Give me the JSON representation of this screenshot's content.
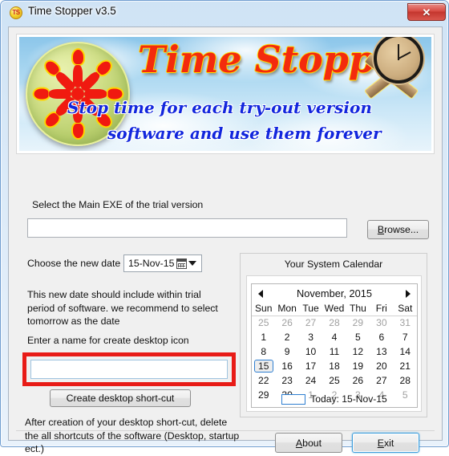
{
  "window": {
    "title": "Time Stopper v3.5",
    "icon_label": "TS",
    "close_label": "✕"
  },
  "banner": {
    "title": "Time Stopper",
    "subtitle_line1": "Stop time for each try-out version",
    "subtitle_line2": "software and use them forever"
  },
  "form": {
    "exe_label": "Select the Main EXE of the trial version",
    "exe_value": "",
    "exe_placeholder": "",
    "browse_label": "Browse...",
    "browse_accesskey": "B",
    "date_label": "Choose the new date",
    "date_value": "15-Nov-15",
    "hint_paragraph": "This new date should include within trial period of software. we recommend to select tomorrow as the date",
    "name_label": "Enter a name for create desktop icon",
    "name_value": "",
    "name_placeholder": "",
    "create_shortcut_label": "Create desktop short-cut",
    "footer_note": "After creation of your desktop short-cut, delete the all shortcuts of the software (Desktop, startup ect.)"
  },
  "calendar": {
    "group_title": "Your System Calendar",
    "month_label": "November, 2015",
    "prev_label": "◄",
    "next_label": "►",
    "weekdays": [
      "Sun",
      "Mon",
      "Tue",
      "Wed",
      "Thu",
      "Fri",
      "Sat"
    ],
    "weeks": [
      [
        {
          "d": "25",
          "dim": true
        },
        {
          "d": "26",
          "dim": true
        },
        {
          "d": "27",
          "dim": true
        },
        {
          "d": "28",
          "dim": true
        },
        {
          "d": "29",
          "dim": true
        },
        {
          "d": "30",
          "dim": true
        },
        {
          "d": "31",
          "dim": true
        }
      ],
      [
        {
          "d": "1"
        },
        {
          "d": "2"
        },
        {
          "d": "3"
        },
        {
          "d": "4"
        },
        {
          "d": "5"
        },
        {
          "d": "6"
        },
        {
          "d": "7"
        }
      ],
      [
        {
          "d": "8"
        },
        {
          "d": "9"
        },
        {
          "d": "10"
        },
        {
          "d": "11"
        },
        {
          "d": "12"
        },
        {
          "d": "13"
        },
        {
          "d": "14"
        }
      ],
      [
        {
          "d": "15",
          "selected": true
        },
        {
          "d": "16"
        },
        {
          "d": "17"
        },
        {
          "d": "18"
        },
        {
          "d": "19"
        },
        {
          "d": "20"
        },
        {
          "d": "21"
        }
      ],
      [
        {
          "d": "22"
        },
        {
          "d": "23"
        },
        {
          "d": "24"
        },
        {
          "d": "25"
        },
        {
          "d": "26"
        },
        {
          "d": "27"
        },
        {
          "d": "28"
        }
      ],
      [
        {
          "d": "29"
        },
        {
          "d": "30"
        },
        {
          "d": "1",
          "dim": true
        },
        {
          "d": "2",
          "dim": true
        },
        {
          "d": "3",
          "dim": true
        },
        {
          "d": "4",
          "dim": true
        },
        {
          "d": "5",
          "dim": true
        }
      ]
    ],
    "today_label": "Today: 15-Nov-15"
  },
  "footer": {
    "about_label": "About",
    "about_accesskey": "A",
    "exit_label": "Exit",
    "exit_accesskey": "E"
  },
  "colors": {
    "highlight_red": "#e81b17",
    "banner_title_red": "#f32b0d",
    "banner_subtitle_blue": "#1226dd",
    "selection_blue": "#2f7fd1",
    "focus_blue": "#3c9ddb",
    "client_bg": "#f0f0f0"
  }
}
